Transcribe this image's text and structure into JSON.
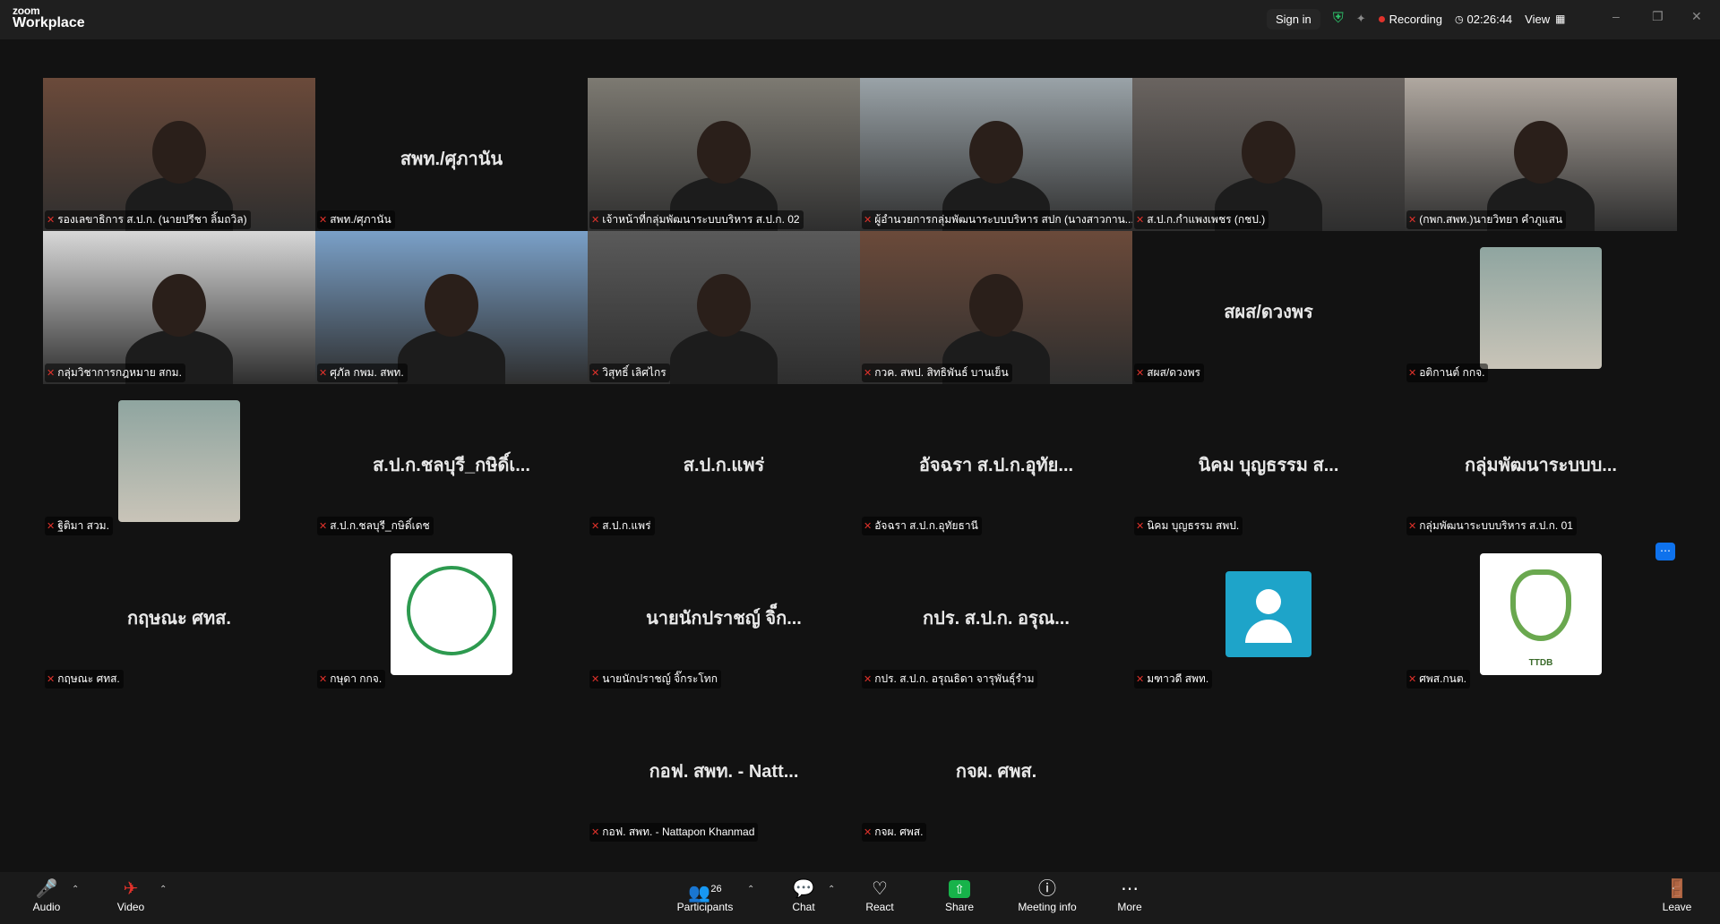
{
  "app": {
    "brand_small": "zoom",
    "brand_big": "Workplace"
  },
  "titlebar": {
    "sign_in": "Sign in",
    "recording_label": "Recording",
    "timer": "02:26:44",
    "view_label": "View"
  },
  "tiles": [
    {
      "label": "รองเลขาธิการ ส.ป.ก. (นายปรีชา ลิ้มถวิล)",
      "name": "",
      "kind": "video",
      "active": true
    },
    {
      "label": "สพท./ศุภานัน",
      "name": "สพท./ศุภานัน",
      "kind": "name"
    },
    {
      "label": "เจ้าหน้าที่กลุ่มพัฒนาระบบบริหาร ส.ป.ก. 02",
      "name": "",
      "kind": "video"
    },
    {
      "label": "ผู้อำนวยการกลุ่มพัฒนาระบบบริหาร สปก (นางสาวกาน...",
      "name": "",
      "kind": "video"
    },
    {
      "label": "ส.ป.ก.กำแพงเพชร (กชป.)",
      "name": "",
      "kind": "video"
    },
    {
      "label": "(กพก.สพท.)นายวิทยา คำภูแสน",
      "name": "",
      "kind": "video"
    },
    {
      "label": "กลุ่มวิชาการกฎหมาย สกม.",
      "name": "",
      "kind": "video"
    },
    {
      "label": "ศุภัล กพม. สพท.",
      "name": "",
      "kind": "video"
    },
    {
      "label": "วิสุทธิ์ เลิศไกร",
      "name": "",
      "kind": "video"
    },
    {
      "label": "กวค. สพป. สิทธิพันธ์ บานเย็น",
      "name": "",
      "kind": "video"
    },
    {
      "label": "สผส/ดวงพร",
      "name": "สผส/ดวงพร",
      "kind": "name"
    },
    {
      "label": "อติกานต์ กกจ.",
      "name": "",
      "kind": "avatar"
    },
    {
      "label": "ฐิติมา สวม.",
      "name": "",
      "kind": "avatar"
    },
    {
      "label": "ส.ป.ก.ชลบุรี_กษิดิ์เดช",
      "name": "ส.ป.ก.ชลบุรี_กษิดิ์เ...",
      "kind": "name"
    },
    {
      "label": "ส.ป.ก.แพร่",
      "name": "ส.ป.ก.แพร่",
      "kind": "name"
    },
    {
      "label": "อัจฉรา ส.ป.ก.อุทัยธานี",
      "name": "อัจฉรา ส.ป.ก.อุทัย...",
      "kind": "name"
    },
    {
      "label": "นิคม บุญธรรม สพป.",
      "name": "นิคม บุญธรรม ส...",
      "kind": "name"
    },
    {
      "label": "กลุ่มพัฒนาระบบบริหาร ส.ป.ก. 01",
      "name": "กลุ่มพัฒนาระบบบ...",
      "kind": "name"
    },
    {
      "label": "กฤษณะ ศทส.",
      "name": "กฤษณะ ศทส.",
      "kind": "name"
    },
    {
      "label": "กษุดา กกจ.",
      "name": "",
      "kind": "logo"
    },
    {
      "label": "นายนักปราชญ์ จิ๊กระโทก",
      "name": "นายนักปราชญ์ จิ็ก...",
      "kind": "name"
    },
    {
      "label": "กปร. ส.ป.ก. อรุณธิดา จารุพันธุ์รำม",
      "name": "กปร. ส.ป.ก. อรุณ...",
      "kind": "name"
    },
    {
      "label": "มฑาวดี สพท.",
      "name": "",
      "kind": "default-avatar"
    },
    {
      "label": "ศพส.กนต.",
      "name": "",
      "kind": "logo2",
      "logo_text": "TTDB"
    },
    {
      "label": "กอฟ. สพท. - Nattapon Khanmad",
      "name": "กอฟ. สพท. - Natt...",
      "kind": "name"
    },
    {
      "label": "กจผ. ศพส.",
      "name": "กจผ. ศพส.",
      "kind": "name"
    }
  ],
  "toolbar": {
    "audio": "Audio",
    "video": "Video",
    "participants": "Participants",
    "participants_count": "26",
    "chat": "Chat",
    "react": "React",
    "share": "Share",
    "meeting_info": "Meeting info",
    "more": "More",
    "leave": "Leave"
  },
  "colors": {
    "active_speaker": "#2dc46b",
    "share_green": "#17b34a",
    "mute_red": "#e0322b",
    "accent_blue": "#0e72ed"
  }
}
